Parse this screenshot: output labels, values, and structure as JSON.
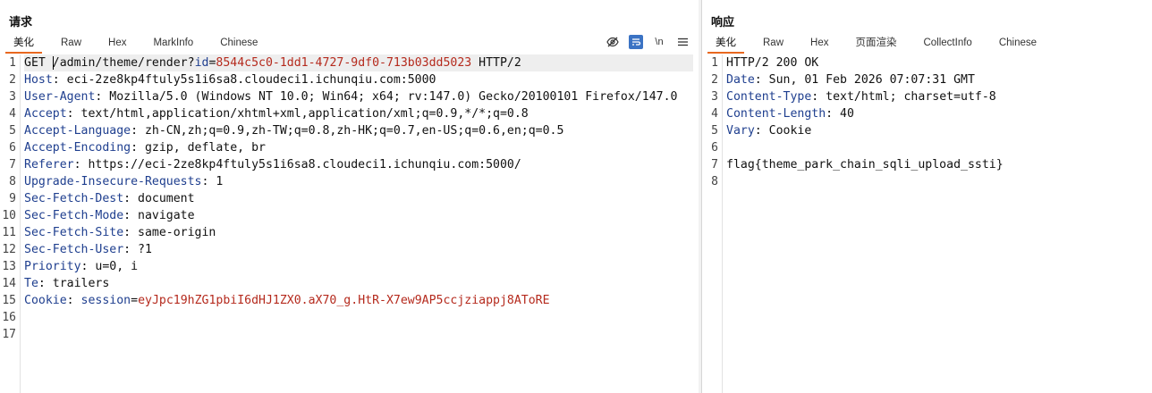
{
  "request": {
    "title": "请求",
    "tabs": [
      "美化",
      "Raw",
      "Hex",
      "MarkInfo",
      "Chinese"
    ],
    "active_tab": 0,
    "tool_icons": [
      "eye-slash-icon",
      "wrap-lines-icon",
      "newline-icon",
      "menu-icon"
    ],
    "newline_label": "\\n",
    "lines": [
      {
        "parts": [
          [
            "GET ",
            "t"
          ],
          [
            "",
            "caret"
          ],
          [
            "/admin/theme/render?",
            "t"
          ],
          [
            "id",
            "pn"
          ],
          [
            "=",
            "t"
          ],
          [
            "8544c5c0-1dd1-4727-9df0-713b03dd5023",
            "pv"
          ],
          [
            " HTTP/2",
            "t"
          ]
        ]
      },
      {
        "parts": [
          [
            "Host",
            "hk"
          ],
          [
            ": eci-2ze8kp4ftuly5s1i6sa8.cloudeci1.ichunqiu.com:5000",
            "t"
          ]
        ]
      },
      {
        "parts": [
          [
            "User-Agent",
            "hk"
          ],
          [
            ": Mozilla/5.0 (Windows NT 10.0; Win64; x64; rv:147.0) Gecko/20100101 Firefox/147.0",
            "t"
          ]
        ]
      },
      {
        "parts": [
          [
            "Accept",
            "hk"
          ],
          [
            ": text/html,application/xhtml+xml,application/xml;q=0.9,*/*;q=0.8",
            "t"
          ]
        ]
      },
      {
        "parts": [
          [
            "Accept-Language",
            "hk"
          ],
          [
            ": zh-CN,zh;q=0.9,zh-TW;q=0.8,zh-HK;q=0.7,en-US;q=0.6,en;q=0.5",
            "t"
          ]
        ]
      },
      {
        "parts": [
          [
            "Accept-Encoding",
            "hk"
          ],
          [
            ": gzip, deflate, br",
            "t"
          ]
        ]
      },
      {
        "parts": [
          [
            "Referer",
            "hk"
          ],
          [
            ": https://eci-2ze8kp4ftuly5s1i6sa8.cloudeci1.ichunqiu.com:5000/",
            "t"
          ]
        ]
      },
      {
        "parts": [
          [
            "Upgrade-Insecure-Requests",
            "hk"
          ],
          [
            ": 1",
            "t"
          ]
        ]
      },
      {
        "parts": [
          [
            "Sec-Fetch-Dest",
            "hk"
          ],
          [
            ": document",
            "t"
          ]
        ]
      },
      {
        "parts": [
          [
            "Sec-Fetch-Mode",
            "hk"
          ],
          [
            ": navigate",
            "t"
          ]
        ]
      },
      {
        "parts": [
          [
            "Sec-Fetch-Site",
            "hk"
          ],
          [
            ": same-origin",
            "t"
          ]
        ]
      },
      {
        "parts": [
          [
            "Sec-Fetch-User",
            "hk"
          ],
          [
            ": ?1",
            "t"
          ]
        ]
      },
      {
        "parts": [
          [
            "Priority",
            "hk"
          ],
          [
            ": u=0, i",
            "t"
          ]
        ]
      },
      {
        "parts": [
          [
            "Te",
            "hk"
          ],
          [
            ": trailers",
            "t"
          ]
        ]
      },
      {
        "parts": [
          [
            "Cookie",
            "hk"
          ],
          [
            ": ",
            "t"
          ],
          [
            "session",
            "pn"
          ],
          [
            "=",
            "t"
          ],
          [
            "eyJpc19hZG1pbiI6dHJ1ZX0.aX70_g.HtR-X7ew9AP5ccjziappj8AToRE",
            "pv"
          ]
        ]
      },
      {
        "parts": []
      },
      {
        "parts": []
      }
    ]
  },
  "response": {
    "title": "响应",
    "tabs": [
      "美化",
      "Raw",
      "Hex",
      "页面渲染",
      "CollectInfo",
      "Chinese"
    ],
    "active_tab": 0,
    "lines": [
      {
        "parts": [
          [
            "HTTP/2 200 OK",
            "t"
          ]
        ]
      },
      {
        "parts": [
          [
            "Date",
            "hk"
          ],
          [
            ": Sun, 01 Feb 2026 07:07:31 GMT",
            "t"
          ]
        ]
      },
      {
        "parts": [
          [
            "Content-Type",
            "hk"
          ],
          [
            ": text/html; charset=utf-8",
            "t"
          ]
        ]
      },
      {
        "parts": [
          [
            "Content-Length",
            "hk"
          ],
          [
            ": 40",
            "t"
          ]
        ]
      },
      {
        "parts": [
          [
            "Vary",
            "hk"
          ],
          [
            ": Cookie",
            "t"
          ]
        ]
      },
      {
        "parts": []
      },
      {
        "parts": [
          [
            "flag{theme_park_chain_sqli_upload_ssti}",
            "t"
          ]
        ]
      },
      {
        "parts": []
      }
    ]
  },
  "colors": {
    "accent_tab": "#e8681f",
    "header_key": "#1f3f8f",
    "param_value": "#b52a1d",
    "tool_on": "#3b73c4"
  }
}
